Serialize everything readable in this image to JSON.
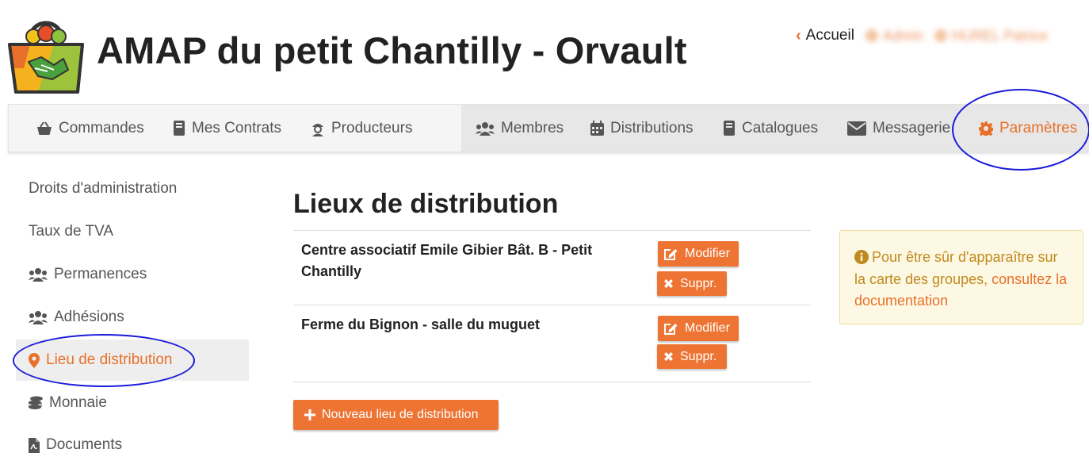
{
  "header": {
    "title": "AMAP du petit Chantilly - Orvault",
    "home_label": "Accueil",
    "blurred_role": "Admin",
    "blurred_user": "HUREL Patrice"
  },
  "navbar": {
    "items": [
      {
        "label": "Commandes",
        "icon": "basket-icon"
      },
      {
        "label": "Mes Contrats",
        "icon": "book-icon"
      },
      {
        "label": "Producteurs",
        "icon": "farmer-icon"
      },
      {
        "label": "Membres",
        "icon": "users-icon"
      },
      {
        "label": "Distributions",
        "icon": "calendar-icon"
      },
      {
        "label": "Catalogues",
        "icon": "book-icon"
      },
      {
        "label": "Messagerie",
        "icon": "envelope-icon"
      },
      {
        "label": "Paramètres",
        "icon": "gear-icon",
        "active": true
      }
    ]
  },
  "sidebar": {
    "items": [
      {
        "label": "Droits d'administration"
      },
      {
        "label": "Taux de TVA"
      },
      {
        "label": "Permanences",
        "icon": "users-icon"
      },
      {
        "label": "Adhésions",
        "icon": "users-icon"
      },
      {
        "label": "Lieu de distribution",
        "icon": "map-marker-icon",
        "active": true
      },
      {
        "label": "Monnaie",
        "icon": "coins-icon"
      },
      {
        "label": "Documents",
        "icon": "pdf-file-icon"
      }
    ]
  },
  "main": {
    "title": "Lieux de distribution",
    "locations": [
      {
        "name": "Centre associatif Emile Gibier Bât. B - Petit Chantilly"
      },
      {
        "name": "Ferme du Bignon - salle du muguet"
      }
    ],
    "edit_label": "Modifier",
    "delete_label": "Suppr.",
    "new_label": "Nouveau lieu de distribution"
  },
  "alert": {
    "text": "Pour être sûr d'apparaître sur la carte des groupes,",
    "link_text": "consultez la documentation"
  },
  "colors": {
    "accent": "#e8702a",
    "button": "#ee7433",
    "highlight": "#1a1adb",
    "alert_bg": "#fdf8e4",
    "alert_text": "#c08a1e"
  }
}
